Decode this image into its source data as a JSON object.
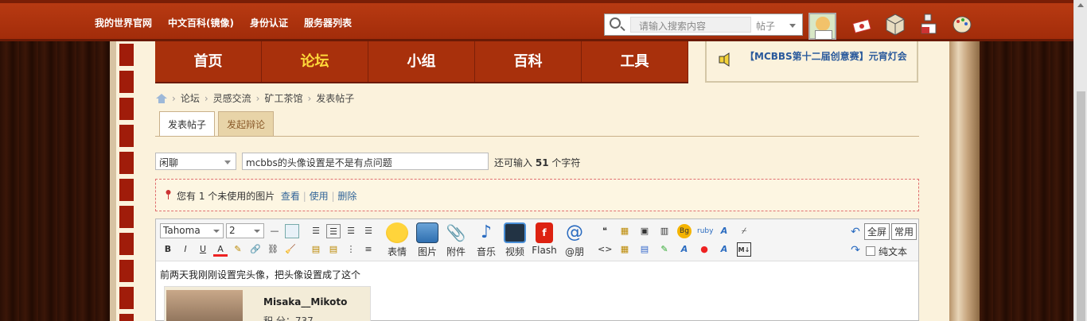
{
  "topbar": {
    "links": [
      "我的世界官网",
      "中文百科(镜像)",
      "身份认证",
      "服务器列表"
    ],
    "search_placeholder": "请输入搜索内容",
    "search_scope": "帖子"
  },
  "nav": {
    "items": [
      "首页",
      "论坛",
      "小组",
      "百科",
      "工具"
    ],
    "active": "论坛"
  },
  "notice": {
    "text": "【MCBBS第十二届创意赛】元宵灯会"
  },
  "breadcrumb": [
    "论坛",
    "灵感交流",
    "矿工茶馆",
    "发表帖子"
  ],
  "tabs": {
    "post": "发表帖子",
    "debate": "发起辩论"
  },
  "form": {
    "type_selected": "闲聊",
    "subject": "mcbbs的头像设置是不是有点问题",
    "remain_prefix": "还可输入",
    "remain_count": "51",
    "remain_suffix": "个字符"
  },
  "image_notice": {
    "text": "您有 1 个未使用的图片",
    "view": "查看",
    "use": "使用",
    "delete": "删除"
  },
  "editor": {
    "font": "Tahoma",
    "size": "2",
    "buttons": {
      "emoji": "表情",
      "image": "图片",
      "attach": "附件",
      "music": "音乐",
      "video": "视频",
      "flash": "Flash",
      "at": "@朋"
    },
    "fullscreen": "全屏",
    "common": "常用",
    "plaintext": "纯文本",
    "content": "前两天我刚刚设置完头像，把头像设置成了这个",
    "card_name": "Misaka__Mikoto",
    "card_points": "积 分：737"
  },
  "colors": {
    "topbar": "#b83a12",
    "nav": "#a8300c",
    "nav_active": "#ffd93a",
    "link": "#336699",
    "page_bg": "#fbf2dc"
  }
}
